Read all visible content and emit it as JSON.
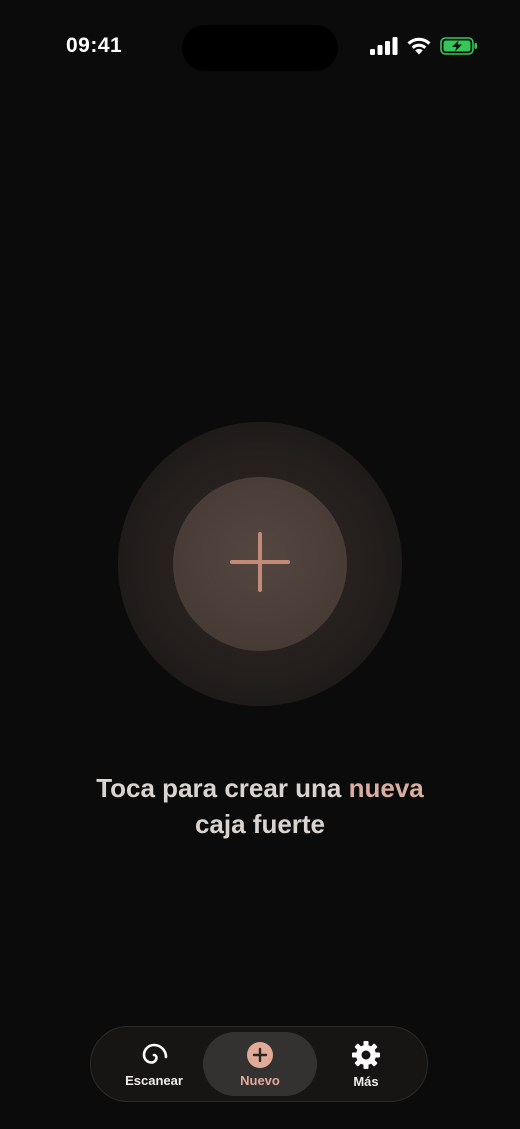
{
  "status_bar": {
    "time": "09:41"
  },
  "main": {
    "prompt_part1": "Toca para crear una ",
    "prompt_accent": "nueva",
    "prompt_part2": "caja fuerte",
    "create_icon": "plus-icon"
  },
  "tab_bar": {
    "tabs": [
      {
        "label": "Escanear",
        "icon": "spiral-icon",
        "active": false
      },
      {
        "label": "Nuevo",
        "icon": "plus-circle-icon",
        "active": true
      },
      {
        "label": "Más",
        "icon": "gear-icon",
        "active": false
      }
    ]
  },
  "colors": {
    "background": "#0b0b0b",
    "accent": "#e2aa98",
    "battery": "#34c759"
  }
}
